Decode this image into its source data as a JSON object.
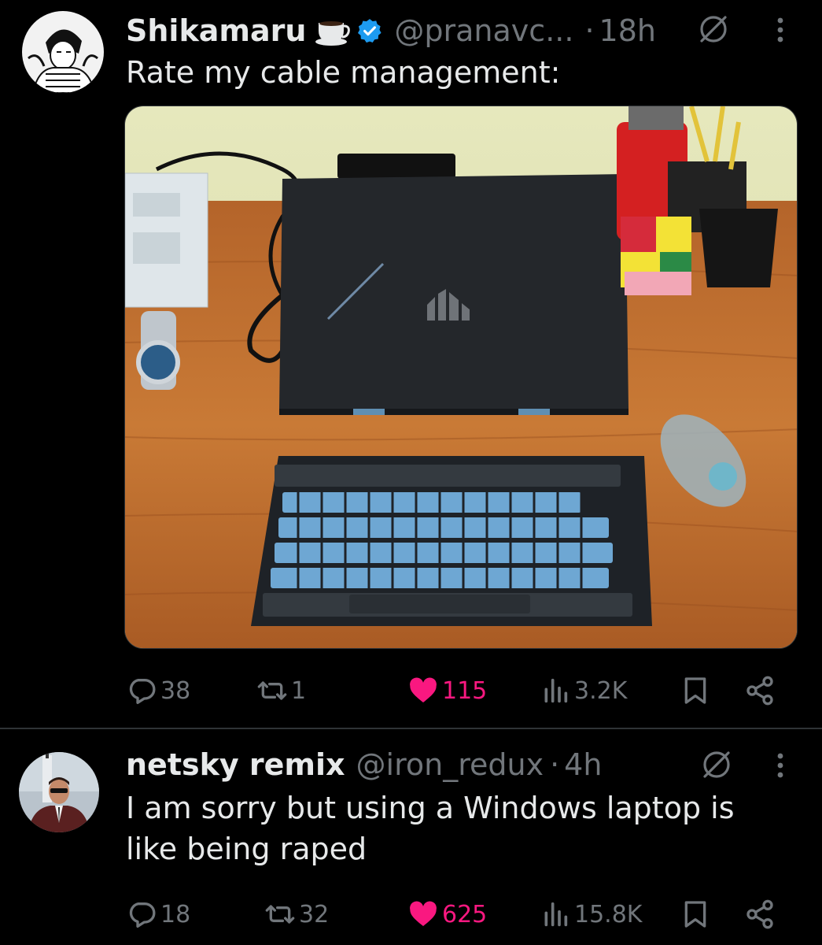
{
  "tweets": [
    {
      "display_name": "Shikamaru",
      "emoji": "coffee-cup",
      "verified": true,
      "handle": "@pranavc...",
      "separator": "·",
      "time": "18h",
      "text": "Rate my cable management:",
      "media": "photo of a black laptop on a stand with a mechanical keyboard, mouse and watch on a wooden desk",
      "stats": {
        "replies": "38",
        "reposts": "1",
        "likes": "115",
        "views": "3.2K"
      },
      "liked": true
    },
    {
      "display_name": "netsky remix",
      "handle": "@iron_redux",
      "separator": "·",
      "time": "4h",
      "text": "I am sorry but using a Windows laptop is\nlike being raped",
      "stats": {
        "replies": "18",
        "reposts": "32",
        "likes": "625",
        "views": "15.8K"
      },
      "liked": true
    }
  ],
  "colors": {
    "background": "#000000",
    "text": "#e7e9ea",
    "secondary": "#71767b",
    "like": "#f91880",
    "verified": "#1d9bf0",
    "divider": "#2f3336"
  },
  "icons": [
    "reply-icon",
    "repost-icon",
    "like-icon",
    "views-icon",
    "bookmark-icon",
    "share-icon",
    "grok-icon",
    "more-icon",
    "verified-icon"
  ]
}
